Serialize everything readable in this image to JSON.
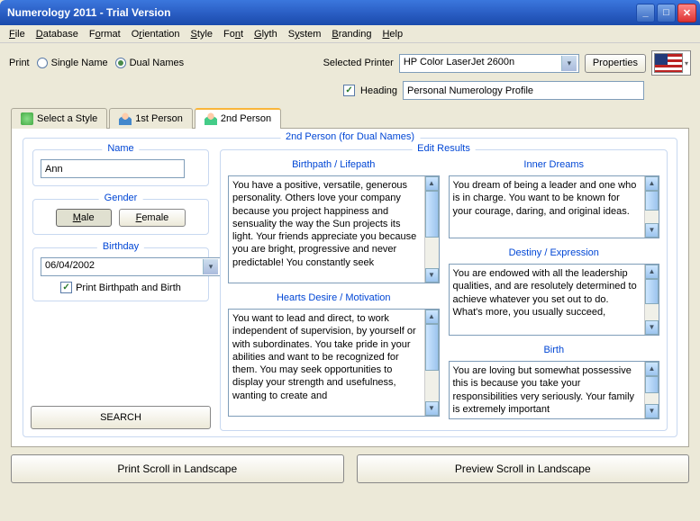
{
  "window": {
    "title": "Numerology 2011 - Trial Version"
  },
  "menu": [
    "File",
    "Database",
    "Format",
    "Orientation",
    "Style",
    "Font",
    "Glyth",
    "System",
    "Branding",
    "Help"
  ],
  "toolbar": {
    "print_label": "Print",
    "single_name": "Single Name",
    "dual_names": "Dual Names",
    "selected_printer_label": "Selected Printer",
    "printer_value": "HP Color LaserJet 2600n",
    "properties": "Properties",
    "heading_label": "Heading",
    "heading_value": "Personal Numerology Profile"
  },
  "tabs": {
    "select_style": "Select a Style",
    "first_person": "1st Person",
    "second_person": "2nd Person"
  },
  "panel": {
    "title": "2nd Person (for Dual Names)",
    "name_label": "Name",
    "name_value": "Ann",
    "gender_label": "Gender",
    "male": "Male",
    "female": "Female",
    "birthday_label": "Birthday",
    "birthday_value": "06/04/2002",
    "print_birthpath": "Print Birthpath and Birth",
    "search": "SEARCH"
  },
  "edit": {
    "title": "Edit Results",
    "birthpath": {
      "label": "Birthpath / Lifepath",
      "text": "You have a positive, versatile, generous personality.  Others love your company because you project happiness and sensuality the way the Sun projects its light.  Your friends appreciate you because you are bright, progressive and never predictable! You constantly seek"
    },
    "hearts": {
      "label": "Hearts Desire / Motivation",
      "text": "You want to lead and direct, to work independent of supervision, by yourself or with subordinates. You take pride in your abilities and want to be recognized for them. You may seek opportunities to display your strength and usefulness, wanting to create and"
    },
    "inner": {
      "label": "Inner Dreams",
      "text": "You dream of being a leader and one who is in charge.  You want to be known for your courage, daring, and original ideas."
    },
    "destiny": {
      "label": "Destiny / Expression",
      "text": "You are endowed with all the leadership qualities, and are resolutely determined to achieve whatever you set out to do.  What's more, you usually succeed,"
    },
    "birth": {
      "label": "Birth",
      "text": "You are loving but somewhat possessive this is because you take your responsibilities very seriously.  Your family is extremely important"
    }
  },
  "bottom": {
    "print_scroll": "Print Scroll in Landscape",
    "preview_scroll": "Preview Scroll in Landscape"
  }
}
